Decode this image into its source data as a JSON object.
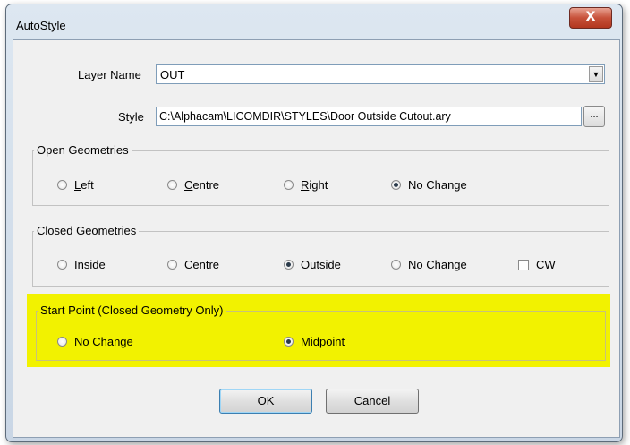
{
  "window": {
    "title": "AutoStyle",
    "close_glyph": "X"
  },
  "layer": {
    "label": "Layer Name",
    "value": "OUT",
    "arrow": "▼"
  },
  "style": {
    "label": "Style",
    "value": "C:\\Alphacam\\LICOMDIR\\STYLES\\Door Outside Cutout.ary",
    "browse_label": "..."
  },
  "open_geometries": {
    "title": "Open Geometries",
    "options": [
      {
        "accel": "L",
        "rest": "eft",
        "checked": false
      },
      {
        "accel": "C",
        "rest": "entre",
        "checked": false,
        "prefix": ""
      },
      {
        "accel": "R",
        "rest": "ight",
        "checked": false
      },
      {
        "accel": "",
        "rest": "No Change",
        "checked": true
      }
    ]
  },
  "closed_geometries": {
    "title": "Closed Geometries",
    "options": [
      {
        "accel": "I",
        "rest": "nside",
        "checked": false
      },
      {
        "prefix": "C",
        "accel": "e",
        "rest": "ntre",
        "checked": false
      },
      {
        "accel": "O",
        "rest": "utside",
        "checked": true
      },
      {
        "accel": "",
        "rest": "No Change",
        "checked": false
      }
    ],
    "cw": {
      "accel": "C",
      "rest": "W",
      "checked": false
    }
  },
  "start_point": {
    "title": "Start Point (Closed Geometry Only)",
    "highlight_color": "#f2f200",
    "options": [
      {
        "accel": "N",
        "rest": "o Change",
        "checked": false
      },
      {
        "accel": "M",
        "rest": "idpoint",
        "checked": true
      }
    ]
  },
  "buttons": {
    "ok": "OK",
    "cancel": "Cancel"
  }
}
